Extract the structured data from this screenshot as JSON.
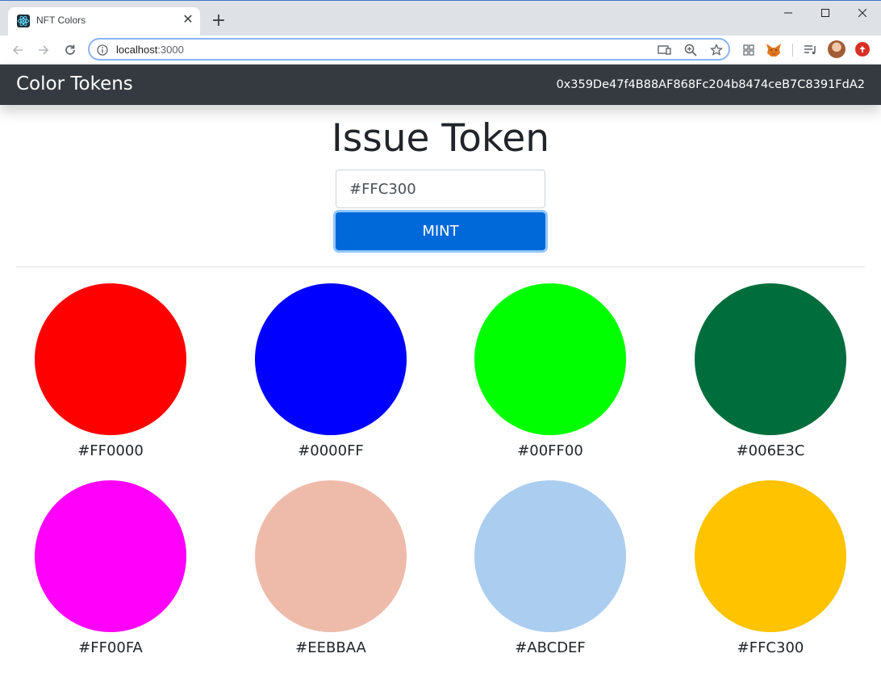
{
  "browser": {
    "tab_title": "NFT Colors",
    "tab_close": "✕",
    "new_tab": "+",
    "url_host": "localhost",
    "url_port": ":3000"
  },
  "app": {
    "brand": "Color Tokens",
    "account": "0x359De47f4B88AF868Fc204b8474ceB7C8391FdA2"
  },
  "mint_form": {
    "heading": "Issue Token",
    "input_value": "#FFC300",
    "button_label": "MINT"
  },
  "tokens": [
    {
      "label": "#FF0000",
      "color": "#FF0000"
    },
    {
      "label": "#0000FF",
      "color": "#0000FF"
    },
    {
      "label": "#00FF00",
      "color": "#00FF00"
    },
    {
      "label": "#006E3C",
      "color": "#006E3C"
    },
    {
      "label": "#FF00FA",
      "color": "#FF00FA"
    },
    {
      "label": "#EEBBAA",
      "color": "#EEBBAA"
    },
    {
      "label": "#ABCDEF",
      "color": "#ABCDEF"
    },
    {
      "label": "#FFC300",
      "color": "#FFC300"
    }
  ]
}
